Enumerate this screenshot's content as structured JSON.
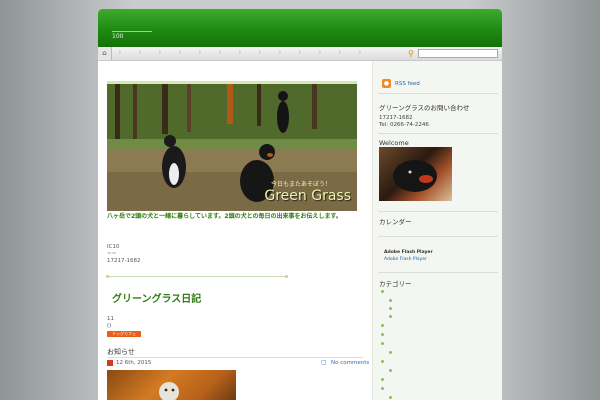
{
  "header": {
    "tagline": "100"
  },
  "nav": {
    "home_icon": "home-icon",
    "search_icon": "search-icon",
    "search_value": ""
  },
  "main": {
    "hero": {
      "title": "Green Grass",
      "subtitle": "今日もまたあそぼう！"
    },
    "hero_caption": "八ヶ岳で2頭の犬と一緒に暮らしています。2頭の犬との毎日の出来事をお伝えします。",
    "lines": [
      "IC10",
      "~~",
      "17217-1682"
    ],
    "diary_banner": "グリーングラス日記",
    "count_lines": [
      "11",
      "()"
    ],
    "badge_text": "ドッグカフェ",
    "post": {
      "title": "お知らせ",
      "date": "12  6th, 2015",
      "comments": "No comments"
    }
  },
  "sidebar": {
    "rss_label": "RSS feed",
    "contact_heading": "グリーングラスのお問い合わせ",
    "contact_lines": [
      "17217-1682",
      "Tel: 0266-74-2246"
    ],
    "welcome_heading": "Welcome",
    "calendar_heading": "カレンダー",
    "flash_title": "Adobe Flash Player",
    "flash_link": "Adobe Flash Player",
    "categories_heading": "カテゴリー"
  }
}
